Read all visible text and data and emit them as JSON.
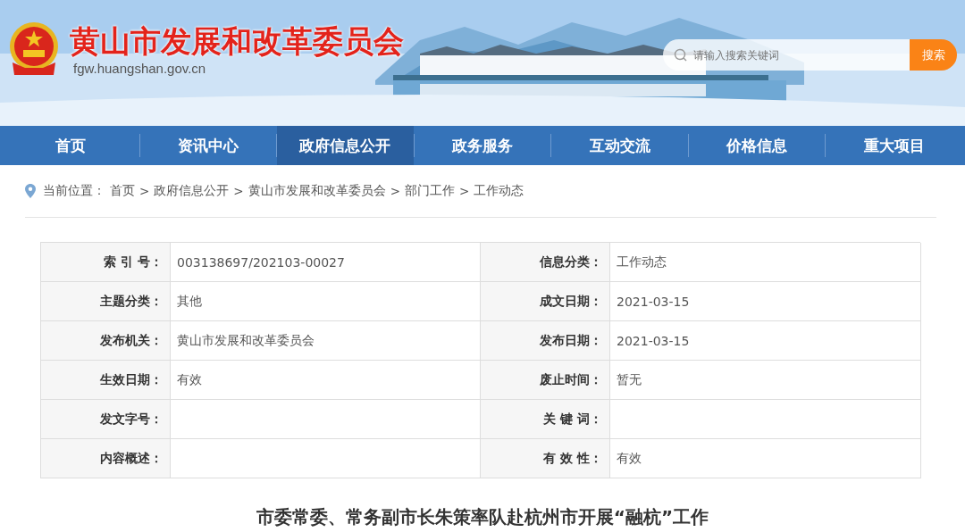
{
  "site": {
    "title": "黄山市发展和改革委员会",
    "url": "fgw.huangshan.gov.cn"
  },
  "search": {
    "placeholder": "请输入搜索关键词",
    "button": "搜索"
  },
  "nav": [
    {
      "label": "首页",
      "selected": false
    },
    {
      "label": "资讯中心",
      "selected": false
    },
    {
      "label": "政府信息公开",
      "selected": true
    },
    {
      "label": "政务服务",
      "selected": false
    },
    {
      "label": "互动交流",
      "selected": false
    },
    {
      "label": "价格信息",
      "selected": false
    },
    {
      "label": "重大项目",
      "selected": false
    }
  ],
  "breadcrumb": {
    "prefix": "当前位置：",
    "separator": ">",
    "items": [
      "首页",
      "政府信息公开",
      "黄山市发展和改革委员会",
      "部门工作",
      "工作动态"
    ]
  },
  "info_table": [
    [
      {
        "label": "索 引 号：",
        "value": "003138697/202103-00027"
      },
      {
        "label": "信息分类：",
        "value": "工作动态"
      }
    ],
    [
      {
        "label": "主题分类：",
        "value": "其他"
      },
      {
        "label": "成文日期：",
        "value": "2021-03-15"
      }
    ],
    [
      {
        "label": "发布机关：",
        "value": "黄山市发展和改革委员会"
      },
      {
        "label": "发布日期：",
        "value": "2021-03-15"
      }
    ],
    [
      {
        "label": "生效日期：",
        "value": "有效"
      },
      {
        "label": "废止时间：",
        "value": "暂无"
      }
    ],
    [
      {
        "label": "发文字号："
      },
      {
        "label": "关 键 词："
      }
    ],
    [
      {
        "label": "内容概述："
      },
      {
        "label": "有 效 性：",
        "value": "有效"
      }
    ]
  ],
  "article": {
    "title": "市委常委、常务副市长朱策率队赴杭州市开展“融杭”工作"
  }
}
